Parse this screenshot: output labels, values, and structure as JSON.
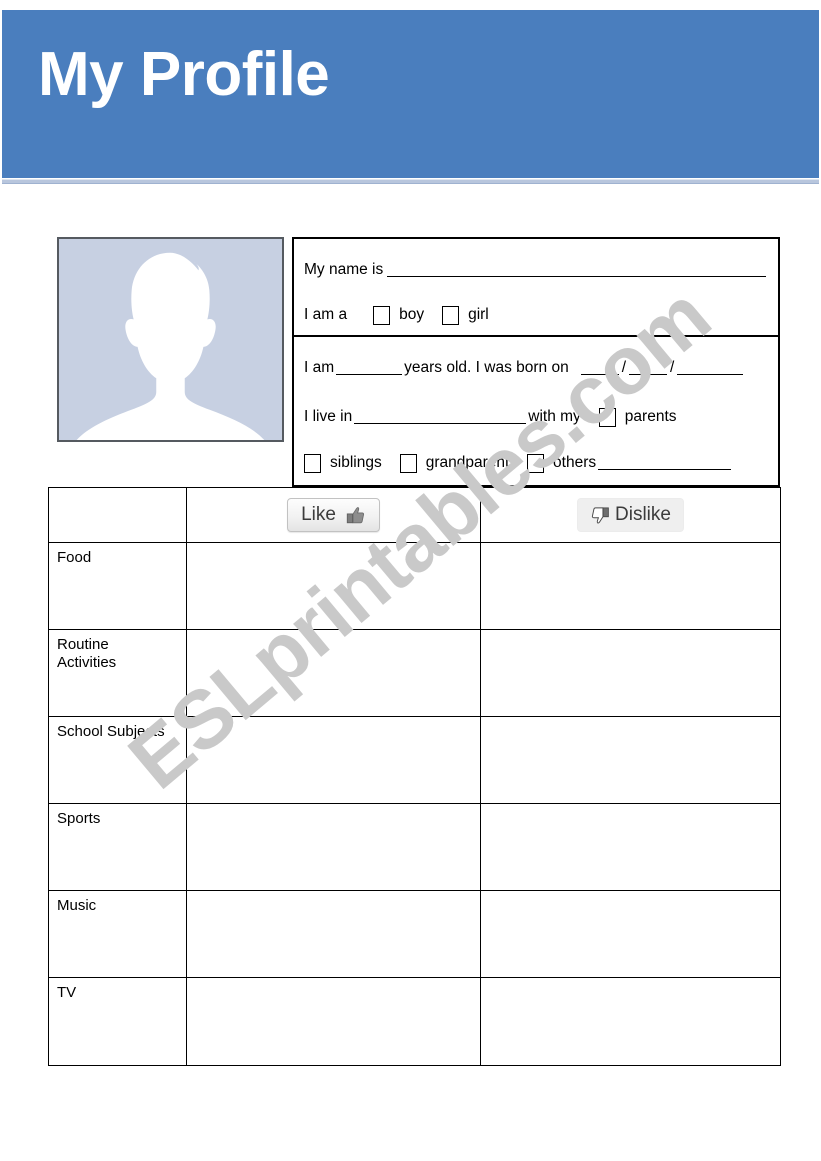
{
  "header": {
    "title": "My Profile",
    "banner_color": "#4a7ebe",
    "title_color": "#ffffff"
  },
  "watermark": {
    "text": "ESLprintables.com",
    "color": "#c9c9c9"
  },
  "avatar": {
    "icon": "person-silhouette-icon",
    "background_color": "#c7d0e2",
    "silhouette_color": "#ffffff"
  },
  "info": {
    "identity": {
      "name_label": "My name is",
      "gender_label": "I am a",
      "gender_options": [
        "boy",
        "girl"
      ]
    },
    "details": {
      "age_prefix": "I am",
      "age_suffix": "years old. I was born on",
      "date_separator": "/",
      "live_prefix": "I live in",
      "live_suffix": "with my",
      "family_options": [
        "parents",
        "siblings",
        "grandparents",
        "others"
      ]
    }
  },
  "preferences": {
    "columns": [
      "",
      "Like",
      "Dislike"
    ],
    "like_label": "Like",
    "like_icon": "thumbs-up-icon",
    "dislike_label": "Dislike",
    "dislike_icon": "thumbs-down-icon",
    "rows": [
      {
        "label": "Food"
      },
      {
        "label": "Routine\nActivities",
        "line1": "Routine",
        "line2": "Activities"
      },
      {
        "label": "School Subjects"
      },
      {
        "label": "Sports"
      },
      {
        "label": "Music"
      },
      {
        "label": "TV"
      }
    ]
  }
}
